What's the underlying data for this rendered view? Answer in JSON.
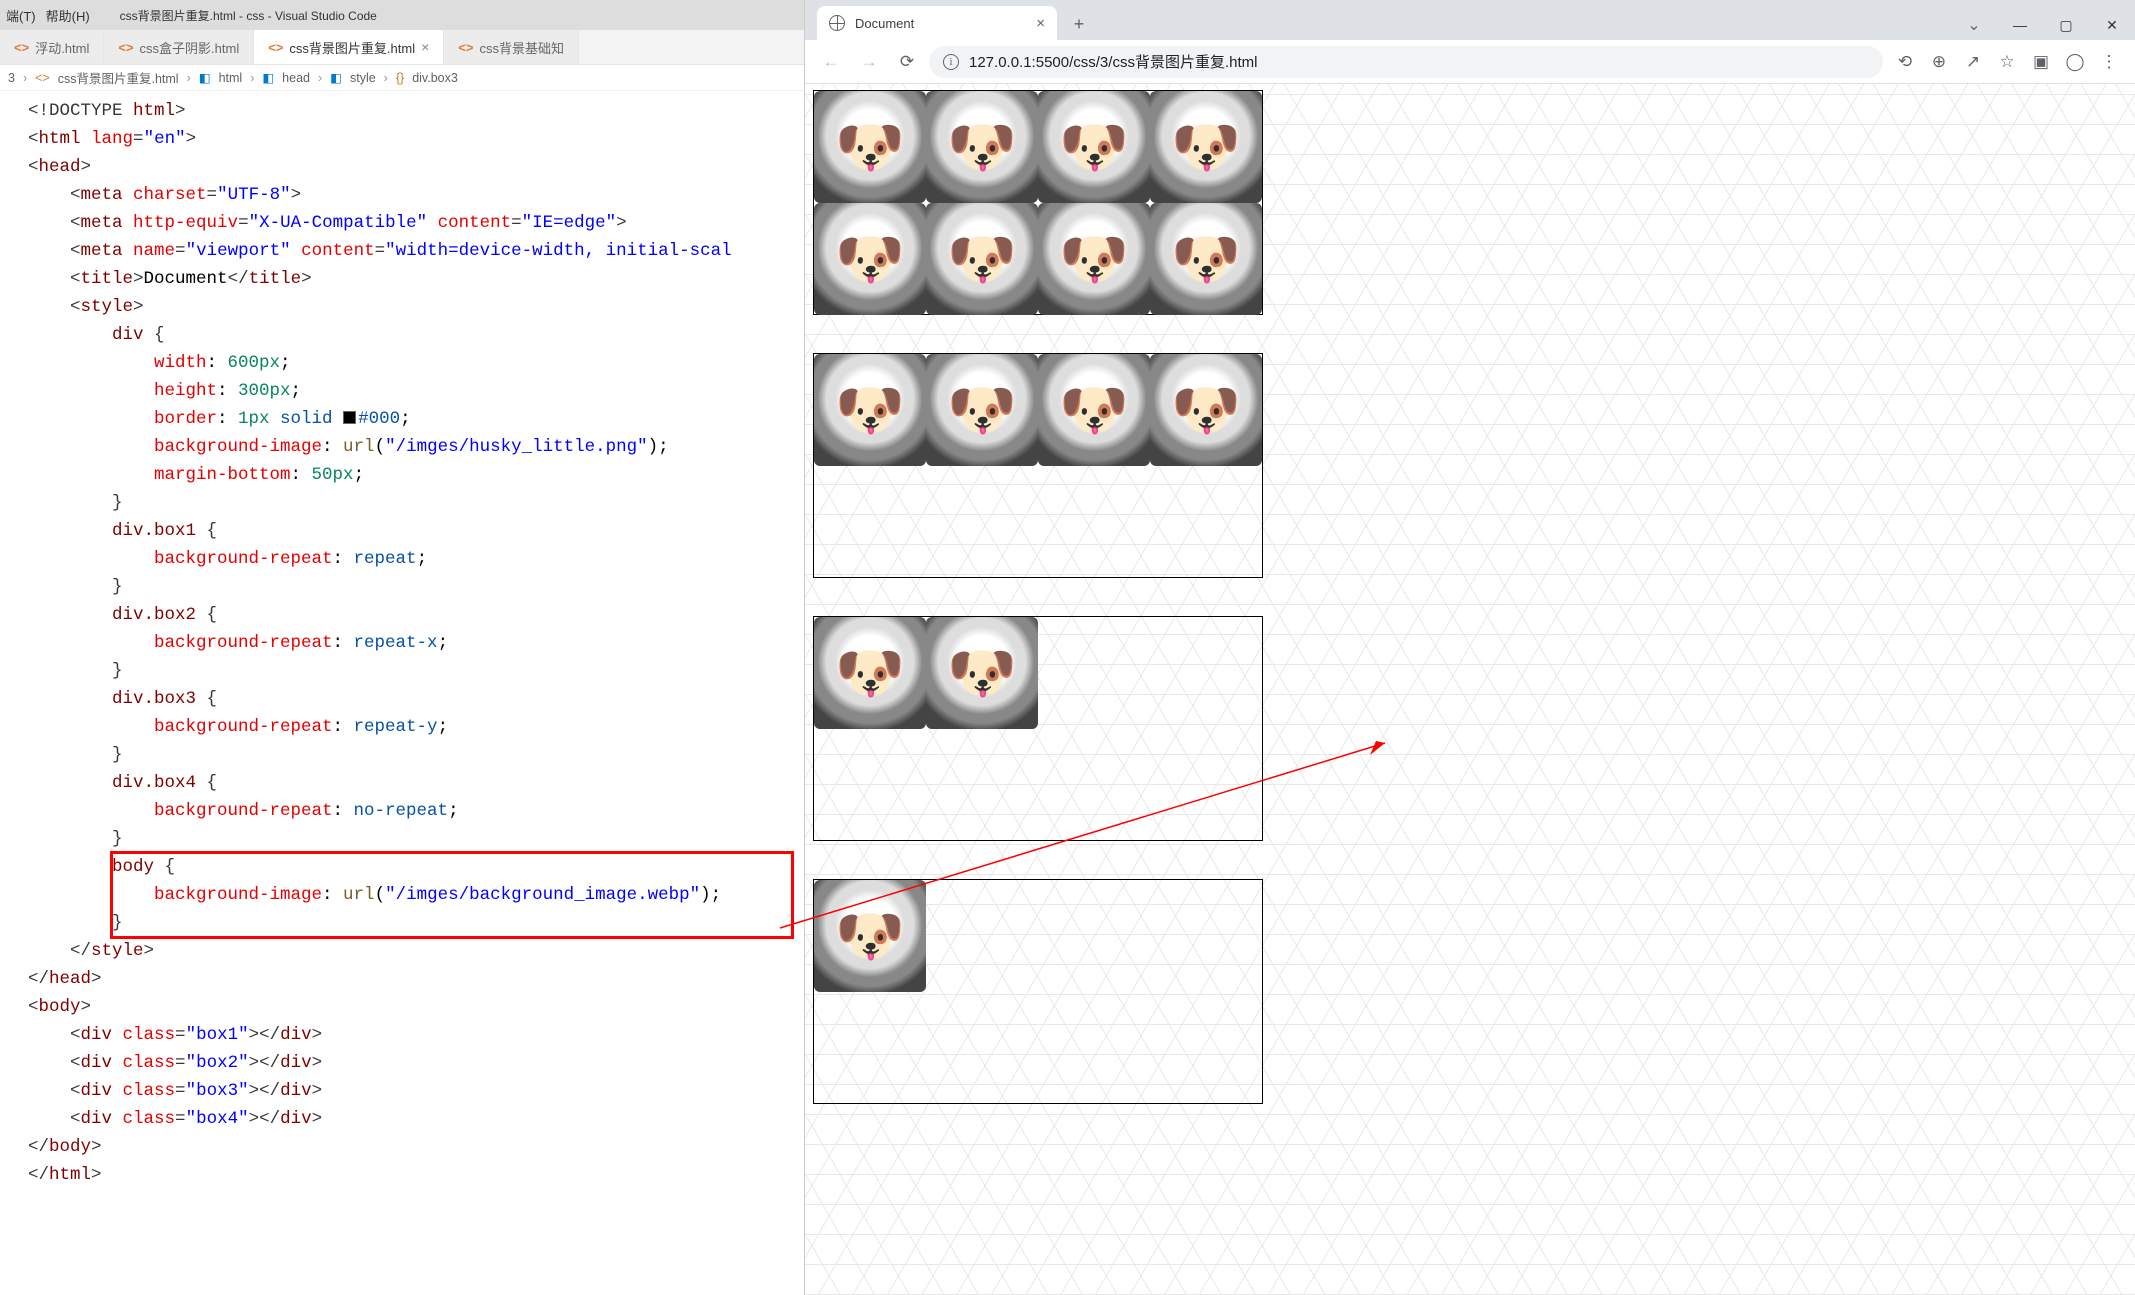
{
  "vscode": {
    "menubar": {
      "item1": "端(T)",
      "item2": "帮助(H)",
      "title": "css背景图片重复.html - css - Visual Studio Code"
    },
    "tabs": [
      {
        "label": "浮动.html"
      },
      {
        "label": "css盒子阴影.html"
      },
      {
        "label": "css背景图片重复.html",
        "active": true
      },
      {
        "label": "css背景基础知"
      }
    ],
    "breadcrumb": {
      "p0": "3",
      "p1": "css背景图片重复.html",
      "p2": "html",
      "p3": "head",
      "p4": "style",
      "p5": "div.box3"
    },
    "code": {
      "l1a": "<!DOCTYPE ",
      "l1b": "html",
      "l1c": ">",
      "l2a": "<",
      "l2b": "html ",
      "l2c": "lang",
      "l2d": "=",
      "l2e": "\"en\"",
      "l2f": ">",
      "l3a": "<",
      "l3b": "head",
      "l3c": ">",
      "l4a": "<",
      "l4b": "meta ",
      "l4c": "charset",
      "l4d": "=",
      "l4e": "\"UTF-8\"",
      "l4f": ">",
      "l5a": "<",
      "l5b": "meta ",
      "l5c": "http-equiv",
      "l5d": "=",
      "l5e": "\"X-UA-Compatible\"",
      "l5f": " content",
      "l5g": "=",
      "l5h": "\"IE=edge\"",
      "l5i": ">",
      "l6a": "<",
      "l6b": "meta ",
      "l6c": "name",
      "l6d": "=",
      "l6e": "\"viewport\"",
      "l6f": " content",
      "l6g": "=",
      "l6h": "\"width=device-width, initial-scal",
      "l7a": "<",
      "l7b": "title",
      "l7c": ">",
      "l7d": "Document",
      "l7e": "</",
      "l7f": "title",
      "l7g": ">",
      "l8a": "<",
      "l8b": "style",
      "l8c": ">",
      "l9a": "div",
      "l9b": " {",
      "l10a": "width",
      "l10b": ": ",
      "l10c": "600px",
      "l10d": ";",
      "l11a": "height",
      "l11b": ": ",
      "l11c": "300px",
      "l11d": ";",
      "l12a": "border",
      "l12b": ": ",
      "l12c": "1px",
      "l12d": " solid ",
      "l12e": "#000",
      "l12f": ";",
      "l13a": "background-image",
      "l13b": ": ",
      "l13c": "url",
      "l13d": "(",
      "l13e": "\"/imges/husky_little.png\"",
      "l13f": ")",
      "l13g": ";",
      "l14a": "margin-bottom",
      "l14b": ": ",
      "l14c": "50px",
      "l14d": ";",
      "l15": "}",
      "l16a": "div.box1",
      "l16b": " {",
      "l17a": "background-repeat",
      "l17b": ": ",
      "l17c": "repeat",
      "l17d": ";",
      "l18": "}",
      "l19a": "div.box2",
      "l19b": " {",
      "l20a": "background-repeat",
      "l20b": ": ",
      "l20c": "repeat-x",
      "l20d": ";",
      "l21": "}",
      "l22a": "div.box3",
      "l22b": " {",
      "l23a": "background-repeat",
      "l23b": ": ",
      "l23c": "repeat-y",
      "l23d": ";",
      "l24": "}",
      "l25a": "div.box4",
      "l25b": " {",
      "l26a": "background-repeat",
      "l26b": ": ",
      "l26c": "no-repeat",
      "l26d": ";",
      "l27": "}",
      "l28a": "body",
      "l28b": " {",
      "l29a": "background-image",
      "l29b": ": ",
      "l29c": "url",
      "l29d": "(",
      "l29e": "\"/imges/background_image.webp\"",
      "l29f": ")",
      "l29g": ";",
      "l30": "}",
      "l31a": "</",
      "l31b": "style",
      "l31c": ">",
      "l32a": "</",
      "l32b": "head",
      "l32c": ">",
      "l33a": "<",
      "l33b": "body",
      "l33c": ">",
      "l34a": "<",
      "l34b": "div ",
      "l34c": "class",
      "l34d": "=",
      "l34e": "\"box1\"",
      "l34f": "></",
      "l34g": "div",
      "l34h": ">",
      "l35a": "<",
      "l35b": "div ",
      "l35c": "class",
      "l35d": "=",
      "l35e": "\"box2\"",
      "l35f": "></",
      "l35g": "div",
      "l35h": ">",
      "l36a": "<",
      "l36b": "div ",
      "l36c": "class",
      "l36d": "=",
      "l36e": "\"box3\"",
      "l36f": "></",
      "l36g": "div",
      "l36h": ">",
      "l37a": "<",
      "l37b": "div ",
      "l37c": "class",
      "l37d": "=",
      "l37e": "\"box4\"",
      "l37f": "></",
      "l37g": "div",
      "l37h": ">",
      "l38a": "</",
      "l38b": "body",
      "l38c": ">",
      "l39a": "</",
      "l39b": "html",
      "l39c": ">"
    }
  },
  "chrome": {
    "tab_title": "Document",
    "url": "127.0.0.1:5500/css/3/css背景图片重复.html"
  }
}
